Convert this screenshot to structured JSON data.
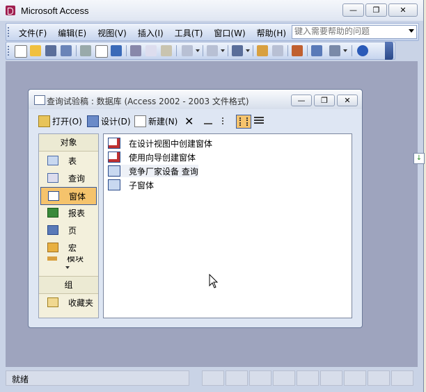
{
  "app": {
    "title": "Microsoft Access"
  },
  "window_controls": {
    "minimize": "—",
    "restore": "❐",
    "close": "✕"
  },
  "menubar": {
    "items": [
      {
        "label": "文件(F)"
      },
      {
        "label": "编辑(E)"
      },
      {
        "label": "视图(V)"
      },
      {
        "label": "插入(I)"
      },
      {
        "label": "工具(T)"
      },
      {
        "label": "窗口(W)"
      },
      {
        "label": "帮助(H)"
      }
    ],
    "help_placeholder": "键入需要帮助的问题"
  },
  "db_window": {
    "title": "查询试验稿 : 数据库 (Access 2002 - 2003 文件格式)",
    "toolbar": {
      "open_label": "打开(O)",
      "design_label": "设计(D)",
      "new_label": "新建(N)"
    },
    "objects_header": "对象",
    "objects": [
      {
        "label": "表",
        "icon": "table-icon"
      },
      {
        "label": "查询",
        "icon": "query-icon"
      },
      {
        "label": "窗体",
        "icon": "form-icon",
        "selected": true
      },
      {
        "label": "报表",
        "icon": "report-icon"
      },
      {
        "label": "页",
        "icon": "page-icon"
      },
      {
        "label": "宏",
        "icon": "macro-icon"
      },
      {
        "label": "模块",
        "icon": "module-icon"
      }
    ],
    "groups_header": "组",
    "groups": [
      {
        "label": "收藏夹",
        "icon": "favorites-icon"
      }
    ],
    "list_items": [
      {
        "label": "在设计视图中创建窗体",
        "icon": "design-wizard-icon"
      },
      {
        "label": "使用向导创建窗体",
        "icon": "wizard-icon"
      },
      {
        "label": "竞争厂家设备 查询",
        "icon": "form-icon"
      },
      {
        "label": "子窗体",
        "icon": "form-icon"
      }
    ]
  },
  "statusbar": {
    "text": "就绪"
  },
  "colors": {
    "workspace": "#9ea4be",
    "selected_object": "#f5c36c"
  }
}
